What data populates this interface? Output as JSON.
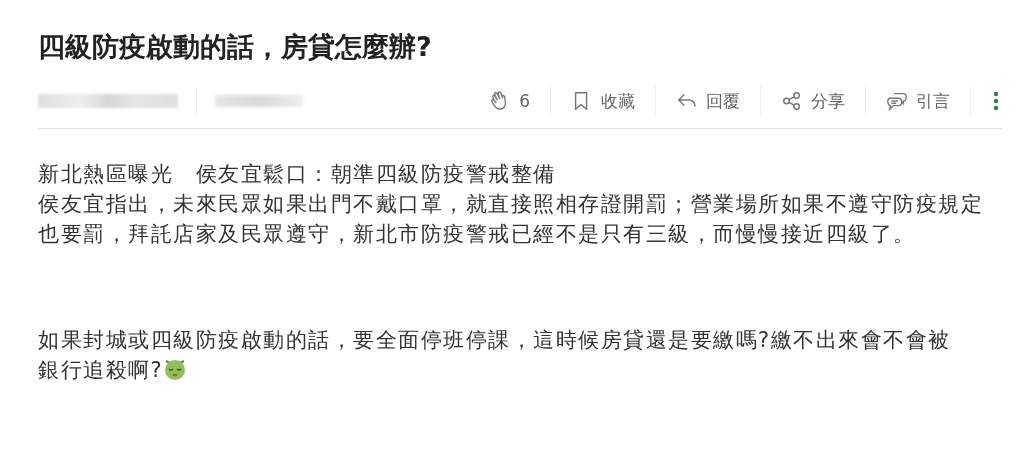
{
  "title": "四級防疫啟動的話，房貸怎麼辦?",
  "actions": [
    {
      "kind": "clap",
      "label": "6"
    },
    {
      "kind": "bookmark",
      "label": "收藏"
    },
    {
      "kind": "reply",
      "label": "回覆"
    },
    {
      "kind": "share",
      "label": "分享"
    },
    {
      "kind": "quote",
      "label": "引言"
    },
    {
      "kind": "more"
    }
  ],
  "body": [
    {
      "text": "新北熱區曝光　侯友宜鬆口：朝準四級防疫警戒整備"
    },
    {
      "text": "侯友宜指出，未來民眾如果出門不戴口罩，就直接照相存證開罰；營業場所如果不遵守防疫規定也要罰，拜託店家及民眾遵守，新北市防疫警戒已經不是只有三級，而慢慢接近四級了。"
    },
    {
      "kind": "gap"
    },
    {
      "kind": "lines_with_emoji",
      "lines": [
        "如果封城或四級防疫啟動的話，要全面停班停課，這時候房貸還是要繳嗎?繳不出來會不會被",
        "銀行追殺啊?"
      ]
    }
  ]
}
